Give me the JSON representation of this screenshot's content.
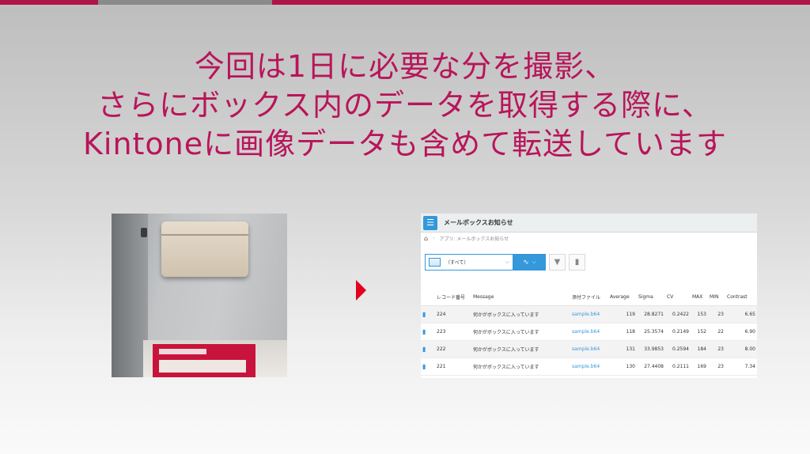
{
  "slide": {
    "title_lines": [
      "今回は1日に必要な分を撮影、",
      "さらにボックス内のデータを取得する際に、",
      "Kintoneに画像データも含めて転送しています"
    ]
  },
  "kintone": {
    "app_title": "メールボックスお知らせ",
    "breadcrumb": "アプリ: メールボックスお知らせ",
    "view_selector": "（すべて）",
    "icons": {
      "app": "list-icon",
      "home": "home-icon",
      "graph": "line-graph-icon",
      "filter": "filter-icon",
      "bar": "bar-chart-icon",
      "file": "document-icon"
    },
    "columns": [
      "レコード番号",
      "Message",
      "添付ファイル",
      "Average",
      "Sigma",
      "CV",
      "MAX",
      "MIN",
      "Contrast"
    ],
    "rows": [
      {
        "id": "224",
        "message": "何かがボックスに入っています",
        "file": "sample.b64",
        "average": "119",
        "sigma": "28.8271",
        "cv": "0.2422",
        "max": "153",
        "min": "23",
        "contrast": "6.65"
      },
      {
        "id": "223",
        "message": "何かがボックスに入っています",
        "file": "sample.b64",
        "average": "118",
        "sigma": "25.3574",
        "cv": "0.2149",
        "max": "152",
        "min": "22",
        "contrast": "6.90"
      },
      {
        "id": "222",
        "message": "何かがボックスに入っています",
        "file": "sample.b64",
        "average": "131",
        "sigma": "33.9853",
        "cv": "0.2594",
        "max": "184",
        "min": "23",
        "contrast": "8.00"
      },
      {
        "id": "221",
        "message": "何かがボックスに入っています",
        "file": "sample.b64",
        "average": "130",
        "sigma": "27.4408",
        "cv": "0.2111",
        "max": "169",
        "min": "23",
        "contrast": "7.34"
      }
    ]
  },
  "colors": {
    "accent": "#b0124a",
    "title": "#b8155a",
    "arrow": "#e1001e",
    "kintone_blue": "#3498db"
  }
}
